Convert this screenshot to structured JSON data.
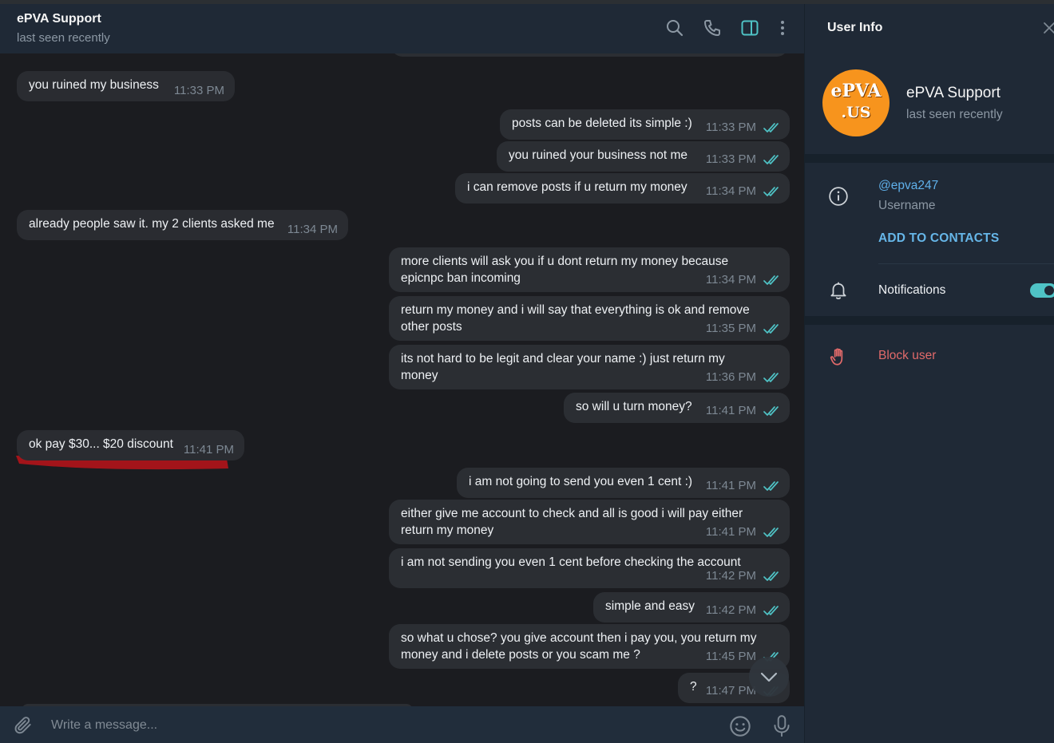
{
  "chat": {
    "title": "ePVA Support",
    "status": "last seen recently",
    "messages": [
      {
        "dir": "in",
        "text": "you ruined my business",
        "time": "11:33 PM"
      },
      {
        "dir": "out",
        "text": "posts can be deleted its simple :)",
        "time": "11:33 PM"
      },
      {
        "dir": "out",
        "text": "you ruined your business not me",
        "time": "11:33 PM"
      },
      {
        "dir": "out",
        "text": "i can remove posts if u return my money",
        "time": "11:34 PM"
      },
      {
        "dir": "in",
        "text": "already people saw it. my 2 clients asked me",
        "time": "11:34 PM"
      },
      {
        "dir": "out",
        "text": "more clients will ask you if u dont return my money because\nepicnpc ban incoming",
        "time": "11:34 PM"
      },
      {
        "dir": "out",
        "text": "return my money and i will say that everything is ok and remove\nother posts",
        "time": "11:35 PM"
      },
      {
        "dir": "out",
        "text": "its not hard to be legit and clear your name :) just return my\nmoney",
        "time": "11:36 PM"
      },
      {
        "dir": "out",
        "text": "so will u turn money?",
        "time": "11:41 PM"
      },
      {
        "dir": "in",
        "text": "ok pay $30... $20 discount",
        "time": "11:41 PM"
      },
      {
        "dir": "out",
        "text": "i am not going to send you even 1 cent :)",
        "time": "11:41 PM"
      },
      {
        "dir": "out",
        "text": "either give me account to check and all is good i will pay either\nreturn my money",
        "time": "11:41 PM"
      },
      {
        "dir": "out",
        "text": "i am not sending you even 1 cent before checking the account",
        "time": "11:42 PM"
      },
      {
        "dir": "out",
        "text": "simple and easy",
        "time": "11:42 PM"
      },
      {
        "dir": "out",
        "text": "so what u chose? you give account then i pay you, you return my\nmoney and i delete posts or you scam me ?",
        "time": "11:45 PM"
      },
      {
        "dir": "out",
        "text": "?",
        "time": "11:47 PM"
      }
    ],
    "input_placeholder": "Write a message...",
    "icons": [
      "search-icon",
      "phone-icon",
      "sidebar-toggle-icon",
      "more-vertical-icon",
      "attach-icon",
      "emoji-icon",
      "microphone-icon",
      "chevron-down-icon"
    ]
  },
  "panel": {
    "title": "User Info",
    "avatar_line1": "ePVA",
    "avatar_line2": ".US",
    "name": "ePVA Support",
    "status": "last seen recently",
    "username": "@epva247",
    "username_label": "Username",
    "add_contact": "ADD TO CONTACTS",
    "notifications": "Notifications",
    "notifications_on": true,
    "block": "Block user"
  },
  "colors": {
    "accent": "#5fb0ea",
    "check": "#4fc3c6",
    "danger": "#e26a6a",
    "avatar": "#f7941d",
    "highlight_mark": "#a3141a"
  }
}
